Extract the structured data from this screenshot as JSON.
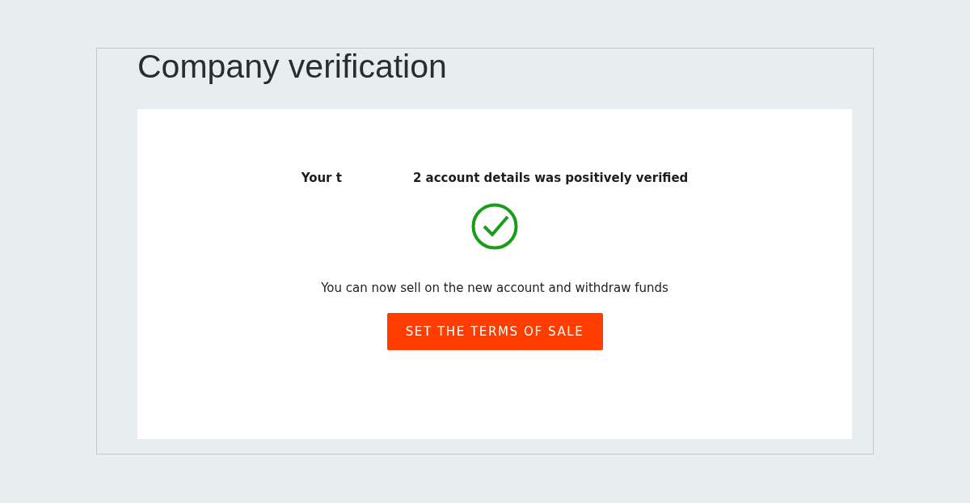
{
  "page": {
    "title": "Company verification"
  },
  "card": {
    "heading_parts": [
      "Your t",
      "2 account details was positively verified"
    ],
    "verified": true,
    "message": "You can now sell on the new account and withdraw funds",
    "button": "SET THE TERMS OF SALE"
  }
}
